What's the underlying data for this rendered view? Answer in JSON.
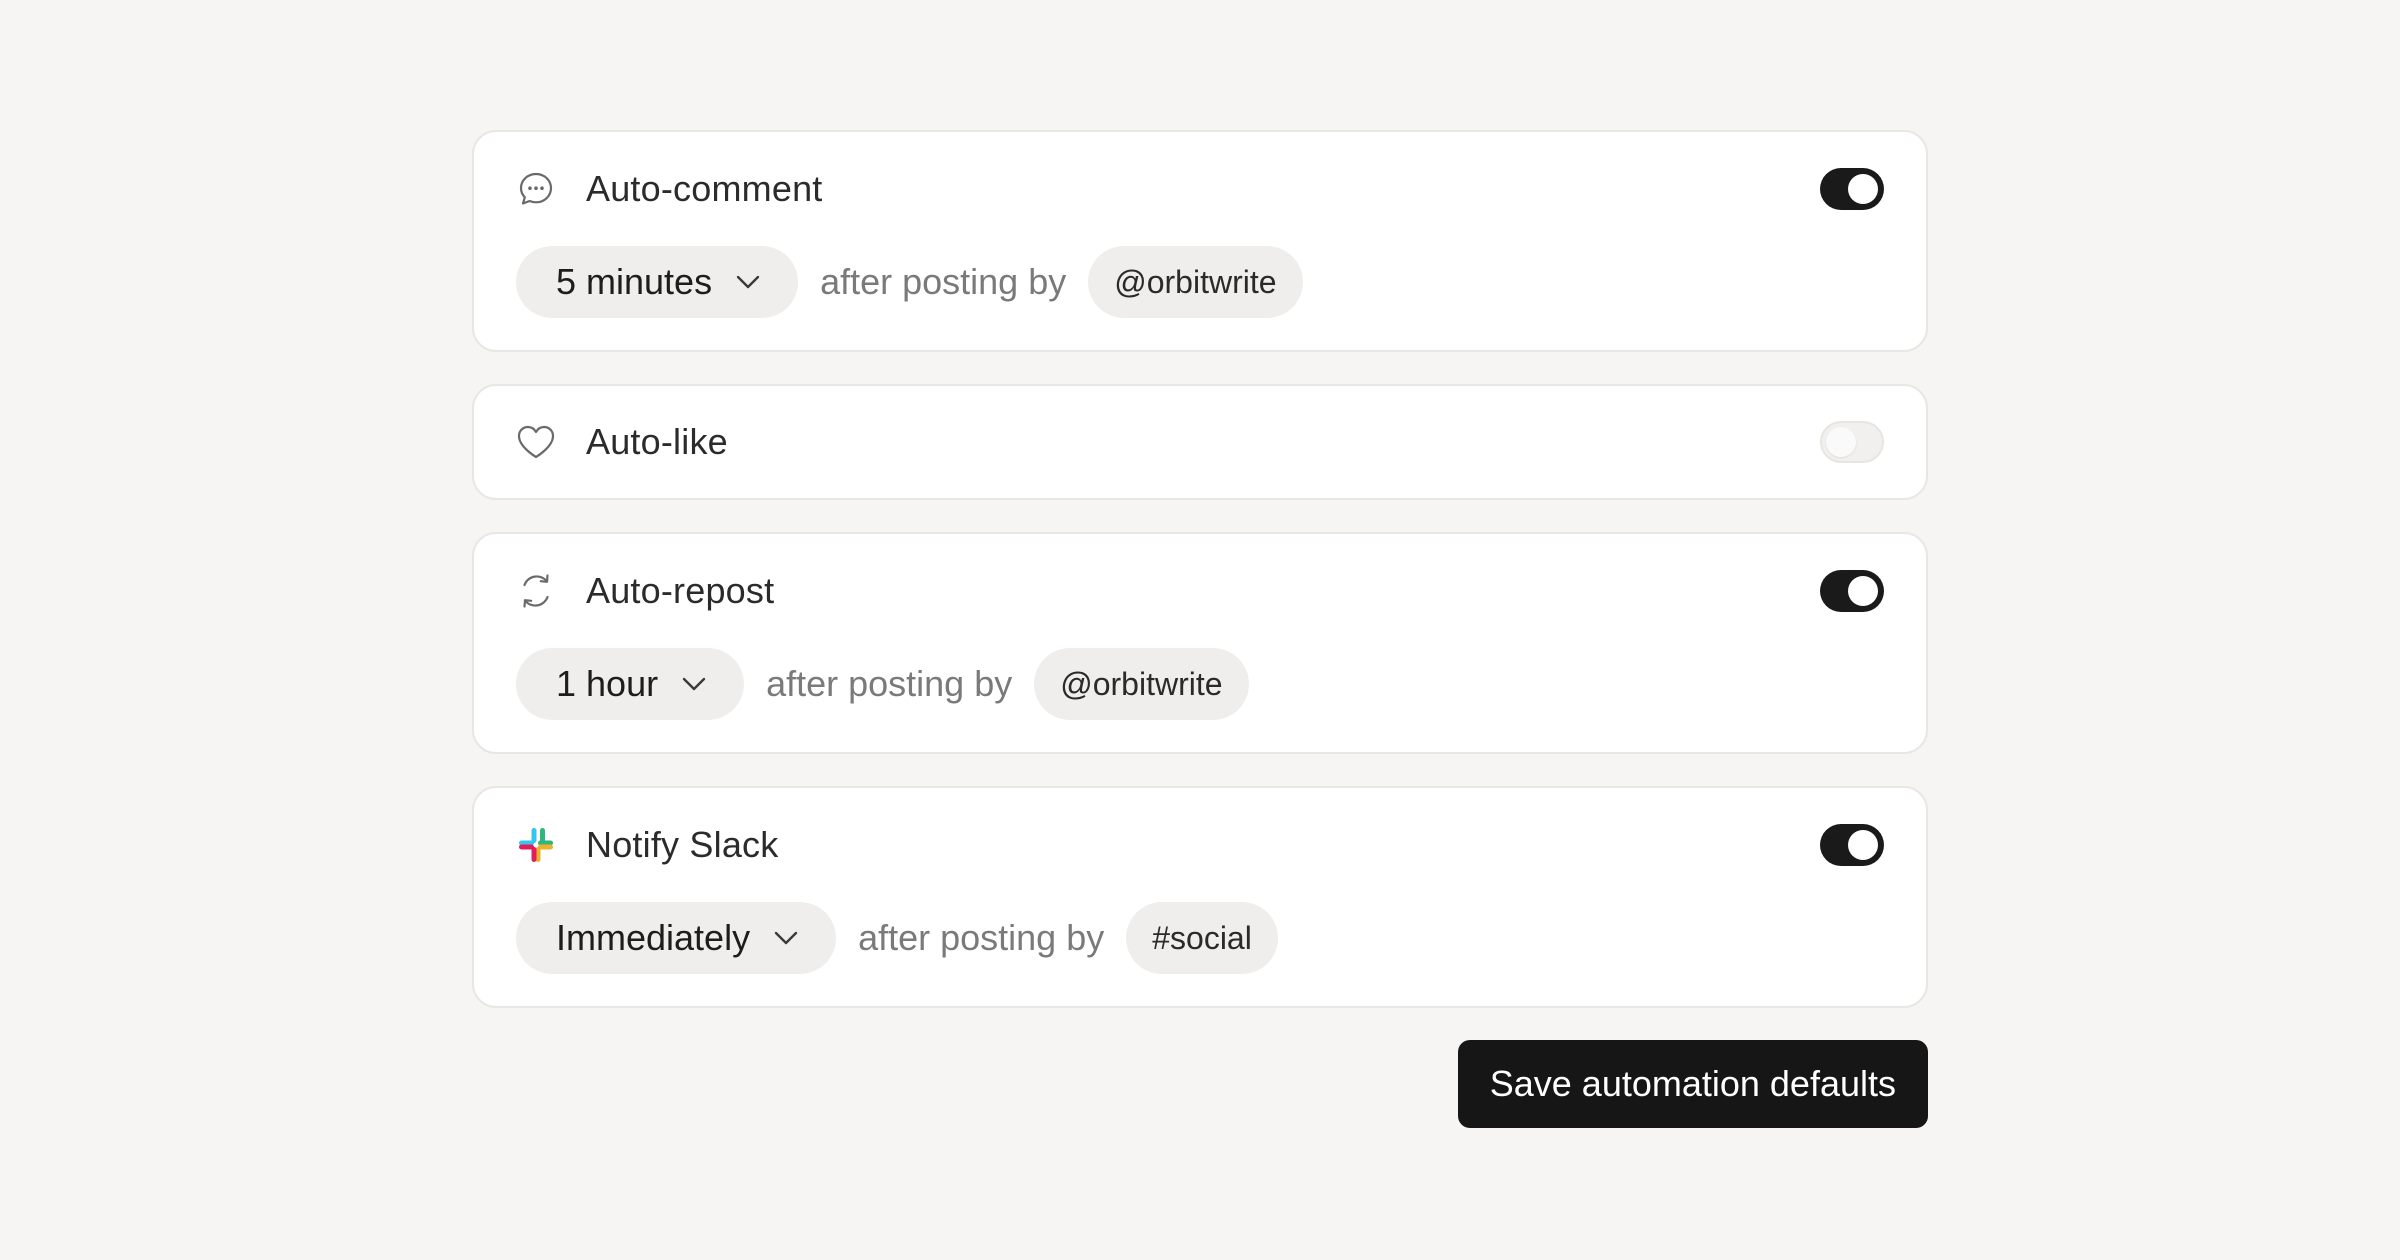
{
  "automations": [
    {
      "title": "Auto-comment",
      "icon": "chat-bubble-icon",
      "enabled": true,
      "delay": "5 minutes",
      "connector": "after posting by",
      "target": "@orbitwrite"
    },
    {
      "title": "Auto-like",
      "icon": "heart-icon",
      "enabled": false
    },
    {
      "title": "Auto-repost",
      "icon": "repost-icon",
      "enabled": true,
      "delay": "1 hour",
      "connector": "after posting by",
      "target": "@orbitwrite"
    },
    {
      "title": "Notify Slack",
      "icon": "slack-icon",
      "enabled": true,
      "delay": "Immediately",
      "connector": "after posting by",
      "target": "#social"
    }
  ],
  "save_button": "Save automation defaults",
  "colors": {
    "background": "#f6f5f3",
    "card": "#ffffff",
    "toggle_on": "#1a1a1a",
    "button": "#161616",
    "slack_blue": "#36c5f0",
    "slack_green": "#2eb67d",
    "slack_yellow": "#ecb22e",
    "slack_red": "#e01e5a"
  }
}
